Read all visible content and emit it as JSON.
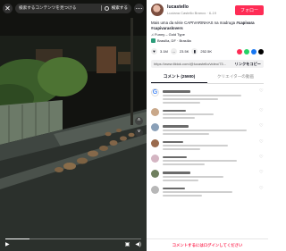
{
  "search": {
    "query": "検索するコンテンツを見つける",
    "button_label": "検索する"
  },
  "author": {
    "name": "lucastello",
    "subtitle": "Luciana Castello Branco · 6-19"
  },
  "follow_label": "フォロー",
  "caption": {
    "text": "Mais uma da série CAPIVARINHAS na madruga",
    "tags": "#capivara #capivaraslovers"
  },
  "music": "♫ Funny – Gold Type",
  "location": "Brasília, DF · Brasília",
  "stats": {
    "likes": "3.1M",
    "comments": "23.5K",
    "saves": "252.5K"
  },
  "link": {
    "url": "https://www.tiktok.com/@lucastello/video/73...",
    "copy_label": "リンクをコピー"
  },
  "tabs": [
    "コメント (25900)",
    "クリエイターの動画"
  ],
  "login_prompt": "コメントするにはログインしてください",
  "colors": {
    "accent": "#fe2c55",
    "dark": "#161823"
  }
}
